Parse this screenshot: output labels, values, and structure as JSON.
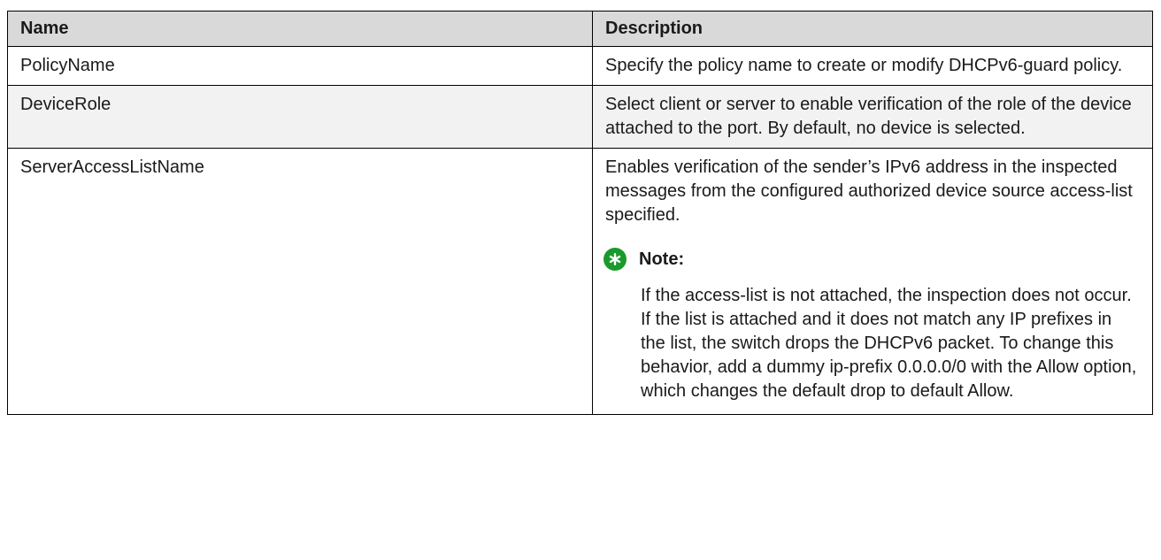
{
  "table": {
    "headers": {
      "name": "Name",
      "description": "Description"
    },
    "rows": [
      {
        "name": "PolicyName",
        "description": "Specify the policy name to create or modify DHCPv6-guard policy."
      },
      {
        "name": "DeviceRole",
        "description": "Select client or server to enable verification of the role of the device attached to the port. By default, no device is selected."
      },
      {
        "name": "ServerAccessListName",
        "description": "Enables verification of the sender’s IPv6 address in the inspected messages from the configured authorized device source access-list specified.",
        "note": {
          "label": "Note:",
          "icon": "asterisk-icon",
          "icon_color": "#1a9a2c",
          "text": "If the access-list is not attached, the inspection does not occur. If the list is attached and it does not match any IP prefixes in the list, the switch drops the DHCPv6 packet. To change this behavior, add a dummy ip-prefix 0.0.0.0/0 with the Allow option, which changes the default drop to default Allow."
        }
      }
    ]
  },
  "colors": {
    "header_background": "#d9d9d9",
    "shaded_row_background": "#f2f2f2",
    "border": "#000000"
  }
}
